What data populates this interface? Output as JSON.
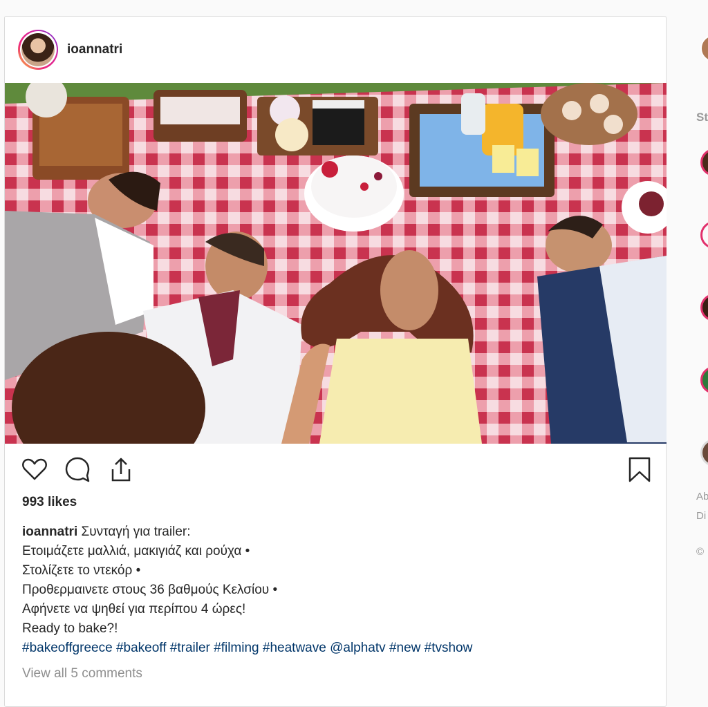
{
  "post": {
    "username": "ioannatri",
    "likes": "993 likes",
    "caption": {
      "username": "ioannatri",
      "lines": [
        "Συνταγή για trailer:",
        "Ετοιμάζετε μαλλιά, μακιγιάζ και ρούχα •",
        "Στολίζετε το ντεκόρ •",
        "Προθερμαινετε στους 36 βαθμούς Κελσίου •",
        "Αφήνετε να ψηθεί για περίπου 4 ώρες!",
        "Ready to bake?!"
      ],
      "hashtags": [
        "#bakeoffgreece",
        "#bakeoff",
        "#trailer",
        "#filming",
        "#heatwave",
        "@alphatv",
        "#new",
        "#tvshow"
      ]
    },
    "view_comments": "View all 5 comments",
    "photo_icon": "image-photo-picnic",
    "action_icons": [
      "heart-icon",
      "comment-icon",
      "share-icon",
      "bookmark-icon"
    ]
  },
  "sidebar": {
    "stories_label": "St",
    "footer_line1": "Ab",
    "footer_line2": "Di",
    "copyright": "©"
  },
  "colors": {
    "link": "#003569",
    "muted": "#8e8e8e",
    "text": "#262626",
    "border": "#dbdbdb"
  }
}
